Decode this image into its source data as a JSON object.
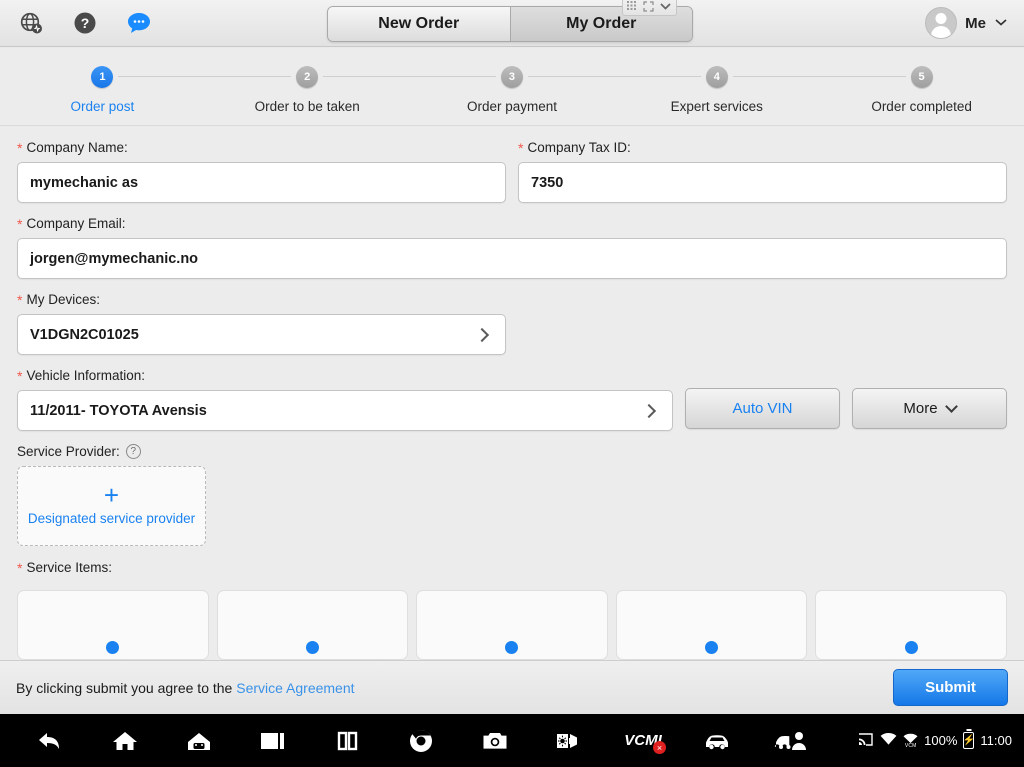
{
  "topbar": {
    "icons": [
      {
        "name": "globe-network-icon",
        "label": "Network"
      },
      {
        "name": "help-circle-icon",
        "label": "Help"
      },
      {
        "name": "chat-bubble-icon",
        "label": "Chat"
      }
    ],
    "tabs": [
      {
        "label": "New Order",
        "active": true
      },
      {
        "label": "My Order",
        "active": false
      }
    ],
    "float_widget": [
      "grid-icon",
      "expand-icon",
      "chevron-down-icon"
    ],
    "user": {
      "name": "Me",
      "chevron": "chevron-down-icon"
    }
  },
  "stepper": {
    "steps": [
      {
        "number": "1",
        "label": "Order post",
        "active": true
      },
      {
        "number": "2",
        "label": "Order to be taken",
        "active": false
      },
      {
        "number": "3",
        "label": "Order payment",
        "active": false
      },
      {
        "number": "4",
        "label": "Expert services",
        "active": false
      },
      {
        "number": "5",
        "label": "Order completed",
        "active": false
      }
    ],
    "active_color": "#1a82f0",
    "inactive_color": "#9e9e9e"
  },
  "form": {
    "company_name": {
      "label": "Company Name:",
      "value": "mymechanic as",
      "required": true
    },
    "company_tax_id": {
      "label": "Company Tax ID:",
      "value": "7350",
      "required": true
    },
    "company_email": {
      "label": "Company Email:",
      "value": "jorgen@mymechanic.no",
      "required": true
    },
    "my_devices": {
      "label": "My Devices:",
      "value": "V1DGN2C01025",
      "required": true,
      "arrow": "chevron-right-icon"
    },
    "vehicle_information": {
      "label": "Vehicle Information:",
      "value": "11/2011- TOYOTA Avensis",
      "required": true,
      "arrow": "chevron-right-icon"
    },
    "auto_vin_button": "Auto VIN",
    "more_button": "More",
    "service_provider": {
      "label": "Service Provider:",
      "help": "?",
      "add_label": "Designated service provider",
      "plus": "+",
      "required": false
    },
    "service_items": {
      "label": "Service Items:",
      "required": true,
      "count": 5
    }
  },
  "footer": {
    "agreement_prefix": "By clicking submit you agree to the ",
    "agreement_link": "Service Agreement",
    "submit_label": "Submit",
    "link_color": "#3a92e8",
    "submit_color": "#1578e8"
  },
  "navbar": {
    "buttons": [
      {
        "name": "back-icon"
      },
      {
        "name": "home-icon"
      },
      {
        "name": "android-home-icon"
      },
      {
        "name": "recents-icon"
      },
      {
        "name": "split-screen-icon"
      },
      {
        "name": "browser-icon"
      },
      {
        "name": "camera-icon"
      },
      {
        "name": "display-settings-icon"
      },
      {
        "name": "vcmi-icon",
        "label": "VCMI",
        "badge": "×"
      },
      {
        "name": "vehicle-icon"
      },
      {
        "name": "remote-service-icon"
      }
    ],
    "status": {
      "cast": "cast-icon",
      "wifi": "wifi-icon",
      "vcm_wifi": "VCM",
      "battery_percent": "100%",
      "battery": "battery-charging-icon",
      "time": "11:00"
    }
  }
}
